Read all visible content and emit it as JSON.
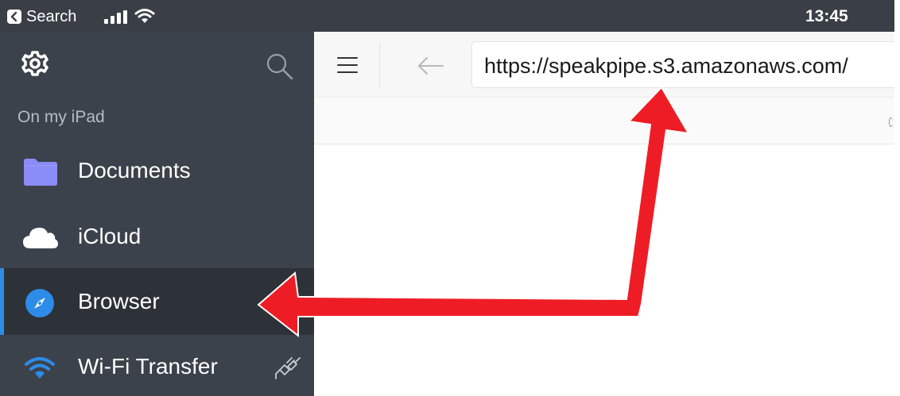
{
  "status_bar": {
    "back_label": "Search",
    "time": "13:45",
    "icons": [
      "back-badge-icon",
      "signal-icon",
      "wifi-icon"
    ]
  },
  "sidebar": {
    "icons": [
      "gear-icon",
      "search-icon"
    ],
    "section_label": "On my iPad",
    "items": [
      {
        "label": "Documents",
        "icon": "folder-icon",
        "active": false
      },
      {
        "label": "iCloud",
        "icon": "cloud-icon",
        "active": false
      },
      {
        "label": "Browser",
        "icon": "compass-icon",
        "active": true
      },
      {
        "label": "Wi-Fi Transfer",
        "icon": "wifi-icon",
        "active": false,
        "trailing_icon": "plug-icon"
      }
    ]
  },
  "browser": {
    "icons": [
      "hamburger-menu-icon",
      "back-arrow-icon"
    ],
    "url": "https://speakpipe.s3.amazonaws.com/"
  },
  "annotation": {
    "color": "#ee1d25",
    "description_icon": "red-arrow"
  },
  "colors": {
    "sidebar_bg": "#3c424b",
    "active_bg": "#2d3138",
    "accent": "#2d8ce8",
    "folder": "#8a8cf7"
  }
}
